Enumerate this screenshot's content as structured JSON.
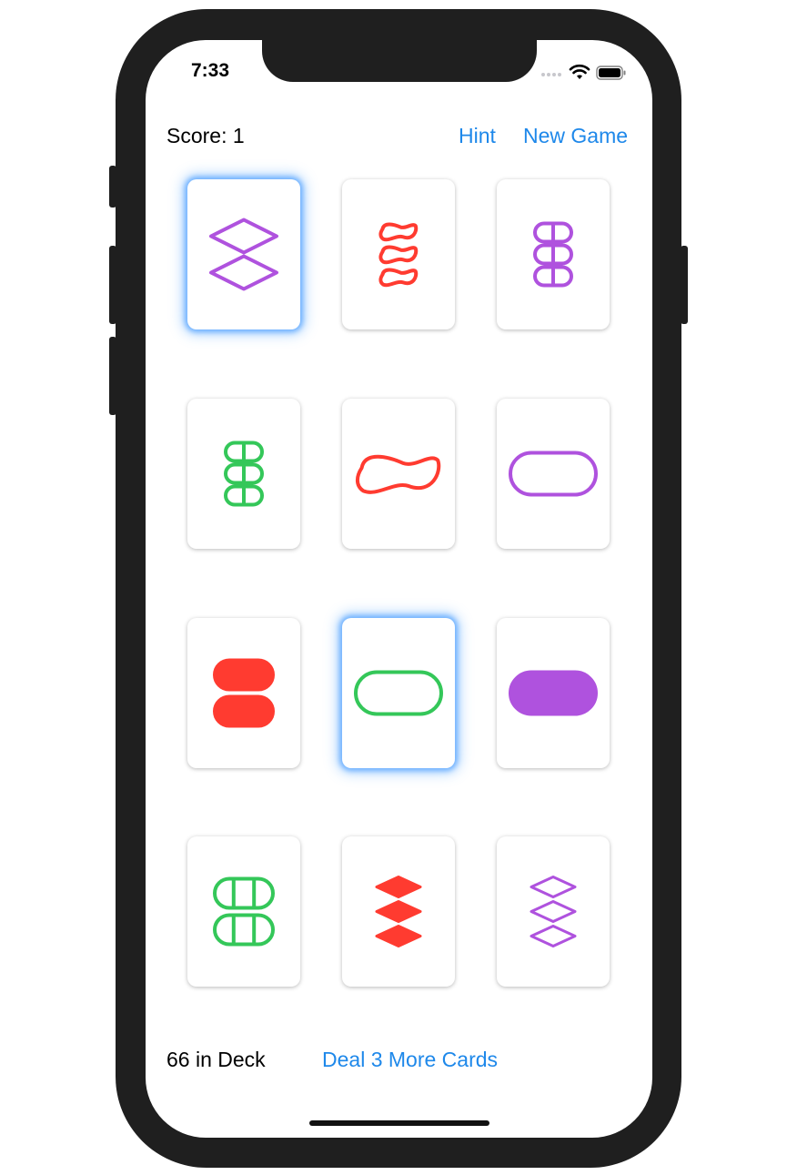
{
  "status_bar": {
    "time": "7:33"
  },
  "header": {
    "score_text": "Score: 1",
    "hint_label": "Hint",
    "new_game_label": "New Game"
  },
  "colors": {
    "purple": "#AF52DE",
    "red": "#FF3B30",
    "green": "#34C759",
    "link": "#1E88EA",
    "selection_glow": "#5AA0FF"
  },
  "cards": [
    {
      "number": 2,
      "shape": "diamond",
      "color": "purple",
      "shading": "open",
      "selected": true
    },
    {
      "number": 3,
      "shape": "squiggle",
      "color": "red",
      "shading": "open",
      "selected": false
    },
    {
      "number": 3,
      "shape": "oval",
      "color": "purple",
      "shading": "striped",
      "selected": false
    },
    {
      "number": 3,
      "shape": "oval",
      "color": "green",
      "shading": "striped",
      "selected": false
    },
    {
      "number": 1,
      "shape": "squiggle",
      "color": "red",
      "shading": "open",
      "selected": false
    },
    {
      "number": 1,
      "shape": "oval",
      "color": "purple",
      "shading": "open",
      "selected": false
    },
    {
      "number": 2,
      "shape": "oval",
      "color": "red",
      "shading": "solid",
      "selected": false
    },
    {
      "number": 1,
      "shape": "oval",
      "color": "green",
      "shading": "open",
      "selected": true
    },
    {
      "number": 1,
      "shape": "oval",
      "color": "purple",
      "shading": "solid",
      "selected": false
    },
    {
      "number": 2,
      "shape": "oval",
      "color": "green",
      "shading": "striped",
      "selected": false
    },
    {
      "number": 3,
      "shape": "diamond",
      "color": "red",
      "shading": "solid",
      "selected": false
    },
    {
      "number": 3,
      "shape": "diamond",
      "color": "purple",
      "shading": "striped",
      "selected": false
    }
  ],
  "footer": {
    "deck_count_text": "66 in Deck",
    "deal_label": "Deal 3 More Cards"
  }
}
